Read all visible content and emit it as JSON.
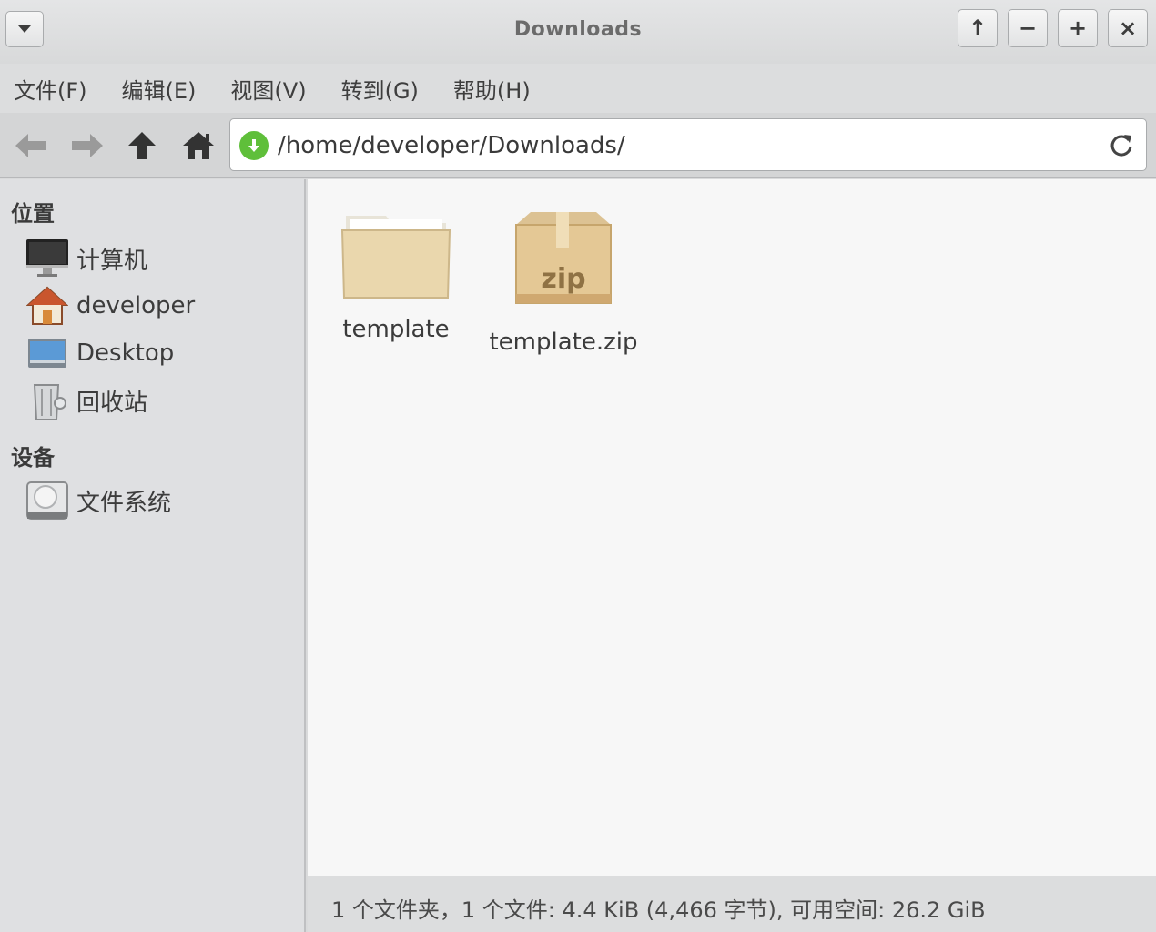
{
  "window": {
    "title": "Downloads",
    "buttons": [
      "↑",
      "−",
      "+",
      "×"
    ]
  },
  "menu": [
    {
      "label": "文件(F)"
    },
    {
      "label": "编辑(E)"
    },
    {
      "label": "视图(V)"
    },
    {
      "label": "转到(G)"
    },
    {
      "label": "帮助(H)"
    }
  ],
  "toolbar": {
    "path": "/home/developer/Downloads/",
    "icons": [
      "back-arrow-icon",
      "forward-arrow-icon",
      "up-arrow-icon",
      "home-icon",
      "download-location-icon",
      "reload-icon"
    ]
  },
  "sidebar": {
    "places_title": "位置",
    "places": [
      {
        "label": "计算机",
        "icon": "computer-icon"
      },
      {
        "label": "developer",
        "icon": "home-folder-icon"
      },
      {
        "label": "Desktop",
        "icon": "desktop-icon"
      },
      {
        "label": "回收站",
        "icon": "trash-icon"
      }
    ],
    "devices_title": "设备",
    "devices": [
      {
        "label": "文件系统",
        "icon": "drive-icon"
      }
    ]
  },
  "files": [
    {
      "name": "template",
      "icon": "folder-icon"
    },
    {
      "name": "template.zip",
      "icon": "zip-archive-icon",
      "badge": "zip"
    }
  ],
  "status": {
    "text": "1 个文件夹，1 个文件: 4.4 KiB (4,466 字节), 可用空间: 26.2 GiB"
  },
  "colors": {
    "accent_green": "#5fbf3a",
    "folder": "#e9d5a8",
    "main_bg": "#f7f7f7",
    "sidebar_bg": "#dfe0e2"
  }
}
